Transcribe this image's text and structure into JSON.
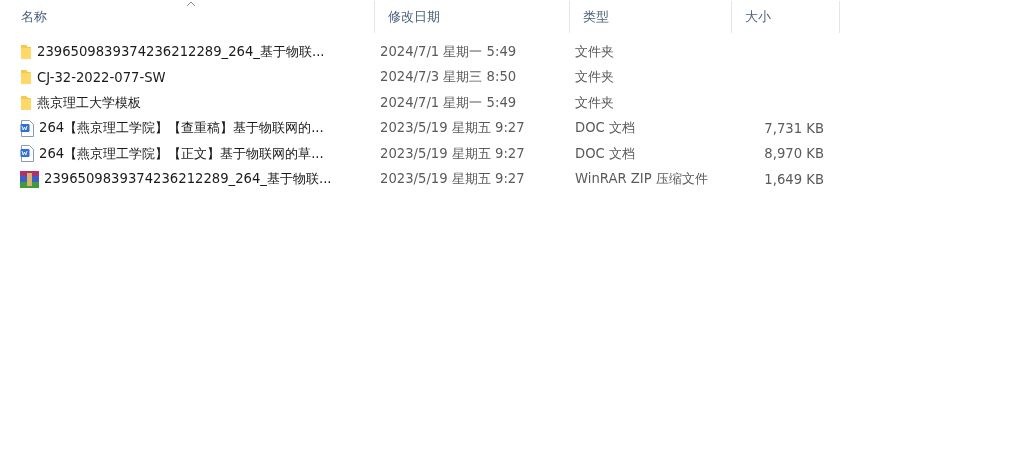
{
  "columns": [
    {
      "label": "名称",
      "sorted": true
    },
    {
      "label": "修改日期",
      "sorted": false
    },
    {
      "label": "类型",
      "sorted": false
    },
    {
      "label": "大小",
      "sorted": false
    }
  ],
  "rows": [
    {
      "kind": "folder",
      "name": "2396509839374236212289_264_基于物联...",
      "date": "2024/7/1 星期一 5:49",
      "type": "文件夹"
    },
    {
      "kind": "folder",
      "name": "CJ-32-2022-077-SW",
      "date": "2024/7/3 星期三 8:50",
      "type": "文件夹"
    },
    {
      "kind": "folder",
      "name": "燕京理工大学模板",
      "date": "2024/7/1 星期一 5:49",
      "type": "文件夹"
    },
    {
      "kind": "word",
      "name": "264【燕京理工学院】【查重稿】基于物联网的...",
      "date": "2023/5/19 星期五 9:27",
      "type": "DOC 文档",
      "size": "7,731 KB"
    },
    {
      "kind": "word",
      "name": "264【燕京理工学院】【正文】基于物联网的草...",
      "date": "2023/5/19 星期五 9:27",
      "type": "DOC 文档",
      "size": "8,970 KB"
    },
    {
      "kind": "archive",
      "name": "2396509839374236212289_264_基于物联...",
      "date": "2023/5/19 星期五 9:27",
      "type": "WinRAR ZIP 压缩文件",
      "size": "1,649 KB"
    }
  ]
}
